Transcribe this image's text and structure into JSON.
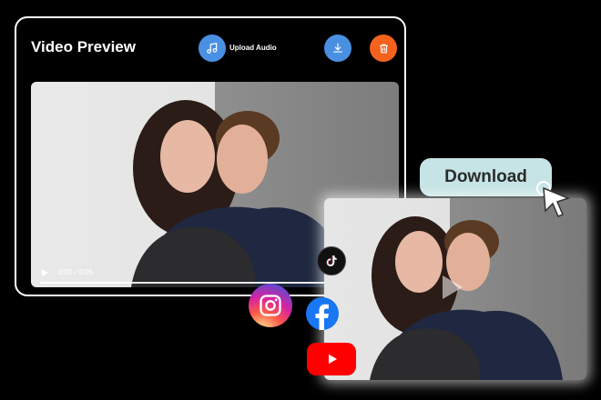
{
  "preview": {
    "title": "Video Preview",
    "upload_label": "Upload Audio",
    "time": "0:05 / 0:05",
    "progress": 1.0
  },
  "download": {
    "label": "Download"
  },
  "colors": {
    "upload_button": "#4a90e2",
    "download_button": "#4a90e2",
    "delete_button": "#f5621e",
    "download_pill": "#c6e4e5"
  },
  "icons": {
    "upload": "music-note-icon",
    "download": "download-icon",
    "delete": "trash-icon",
    "cursor": "cursor-arrow-icon",
    "social": [
      "tiktok-icon",
      "instagram-icon",
      "facebook-icon",
      "youtube-icon"
    ]
  }
}
